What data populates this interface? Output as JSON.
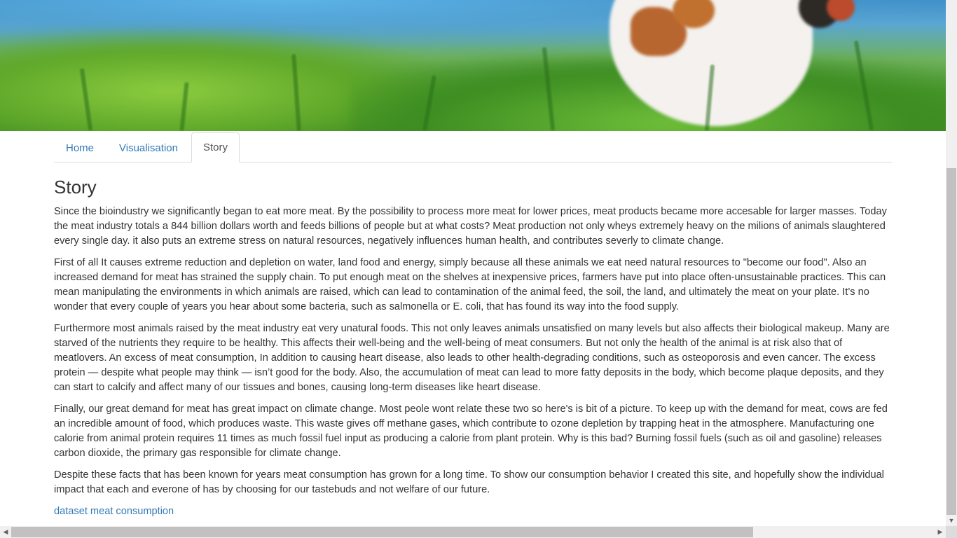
{
  "nav": {
    "tabs": [
      {
        "label": "Home",
        "active": false
      },
      {
        "label": "Visualisation",
        "active": false
      },
      {
        "label": "Story",
        "active": true
      }
    ]
  },
  "story": {
    "heading": "Story",
    "paragraphs": [
      "Since the bioindustry we significantly began to eat more meat. By the possibility to process more meat for lower prices, meat products became more accesable for larger masses. Today the meat industry totals a 844 billion dollars worth and feeds billions of people but at what costs? Meat production not only wheys extremely heavy on the milions of animals slaughtered every single day. it also puts an extreme stress on natural resources, negatively influences human health, and contributes severly to climate change.",
      "First of all It causes extreme reduction and depletion on water, land food and energy, simply because all these animals we eat need natural resources to \"become our food\". Also an increased demand for meat has strained the supply chain. To put enough meat on the shelves at inexpensive prices, farmers have put into place often-unsustainable practices. This can mean manipulating the environments in which animals are raised, which can lead to contamination of the animal feed, the soil, the land, and ultimately the meat on your plate. It’s no wonder that every couple of years you hear about some bacteria, such as salmonella or E. coli, that has found its way into the food supply.",
      "Furthermore most animals raised by the meat industry eat very unatural foods. This not only leaves animals unsatisfied on many levels but also affects their biological makeup. Many are starved of the nutrients they require to be healthy. This affects their well-being and the well-being of meat consumers. But not only the health of the animal is at risk also that of meatlovers. An excess of meat consumption, In addition to causing heart disease, also leads to other health-degrading conditions, such as osteoporosis and even cancer. The excess protein — despite what people may think — isn’t good for the body. Also, the accumulation of meat can lead to more fatty deposits in the body, which become plaque deposits, and they can start to calcify and affect many of our tissues and bones, causing long-term diseases like heart disease.",
      "Finally, our great demand for meat has great impact on climate change. Most peole wont relate these two so here's is bit of a picture. To keep up with the demand for meat, cows are fed an incredible amount of food, which produces waste. This waste gives off methane gases, which contribute to ozone depletion by trapping heat in the atmosphere. Manufacturing one calorie from animal protein requires 11 times as much fossil fuel input as producing a calorie from plant protein. Why is this bad? Burning fossil fuels (such as oil and gasoline) releases carbon dioxide, the primary gas responsible for climate change.",
      "Despite these facts that has been known for years meat consumption has grown for a long time. To show our consumption behavior I created this site, and hopefully show the individual impact that each and everone of has by choosing for our tastebuds and not welfare of our future."
    ],
    "link_text": "dataset meat consumption"
  },
  "scrollbars": {
    "vertical_up_icon": "triangle-up-icon",
    "vertical_down_icon": "triangle-down-icon",
    "horizontal_left_icon": "triangle-left-icon",
    "horizontal_right_icon": "triangle-right-icon"
  },
  "colors": {
    "link": "#337ab7",
    "text": "#333333",
    "active_tab_text": "#555555",
    "border": "#dddddd"
  }
}
